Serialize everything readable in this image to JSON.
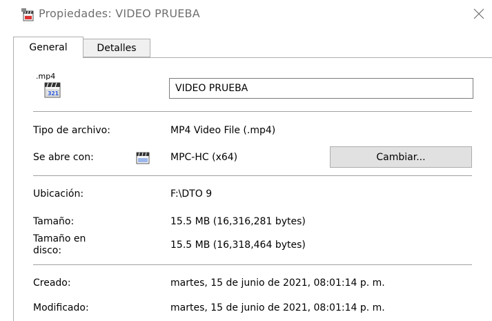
{
  "window": {
    "title": "Propiedades: VIDEO PRUEBA",
    "title_icon": "file-properties-icon",
    "close_icon": "close-icon"
  },
  "tabs": [
    {
      "label": "General",
      "active": true
    },
    {
      "label": "Detalles",
      "active": false
    }
  ],
  "general": {
    "file_icon": "mp4-file-icon",
    "file_icon_ext": ".mp4",
    "file_icon_digits": "321",
    "file_name": "VIDEO PRUEBA",
    "file_type_label": "Tipo de archivo:",
    "file_type_value": "MP4 Video File (.mp4)",
    "opens_with_label": "Se abre con:",
    "opens_with_app_icon": "mpc-hc-icon",
    "opens_with_value": "MPC-HC (x64)",
    "change_button": "Cambiar...",
    "location_label": "Ubicación:",
    "location_value": "F:\\DTO 9",
    "size_label": "Tamaño:",
    "size_value": "15.5 MB (16,316,281 bytes)",
    "size_on_disk_label_1": "Tamaño en",
    "size_on_disk_label_2": "disco:",
    "size_on_disk_value": "15.5 MB (16,318,464 bytes)",
    "created_label": "Creado:",
    "created_value": "martes, 15 de junio de 2021, 08:01:14 p. m.",
    "modified_label": "Modificado:",
    "modified_value": "martes, 15 de junio de 2021, 08:01:14 p. m."
  }
}
